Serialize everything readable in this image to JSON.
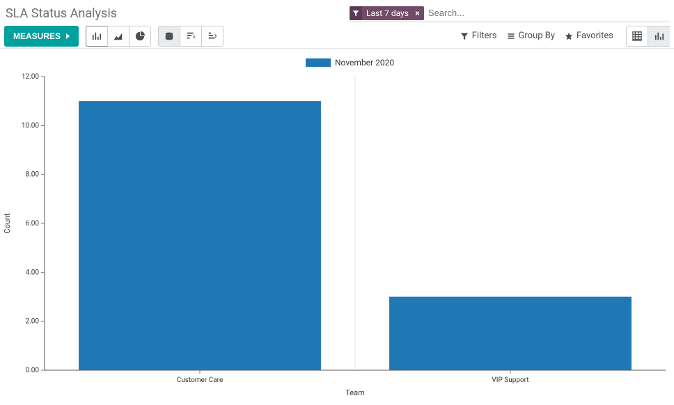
{
  "header": {
    "title": "SLA Status Analysis"
  },
  "search": {
    "facet_label": "Last 7 days",
    "placeholder": "Search..."
  },
  "controls": {
    "measures_label": "Measures",
    "filters_label": "Filters",
    "groupby_label": "Group By",
    "favorites_label": "Favorites"
  },
  "chart_data": {
    "type": "bar",
    "title": "",
    "legend": [
      "November 2020"
    ],
    "categories": [
      "Customer Care",
      "VIP Support"
    ],
    "series": [
      {
        "name": "November 2020",
        "values": [
          11,
          3
        ]
      }
    ],
    "xlabel": "Team",
    "ylabel": "Count",
    "ylim": [
      0,
      12
    ],
    "yticks": [
      0,
      2,
      4,
      6,
      8,
      10,
      12
    ],
    "ytick_labels": [
      "0.00",
      "2.00",
      "4.00",
      "6.00",
      "8.00",
      "10.00",
      "12.00"
    ]
  },
  "colors": {
    "series1": "#1f77b4",
    "primary_button": "#00a09d",
    "facet_bg": "#714b67"
  }
}
